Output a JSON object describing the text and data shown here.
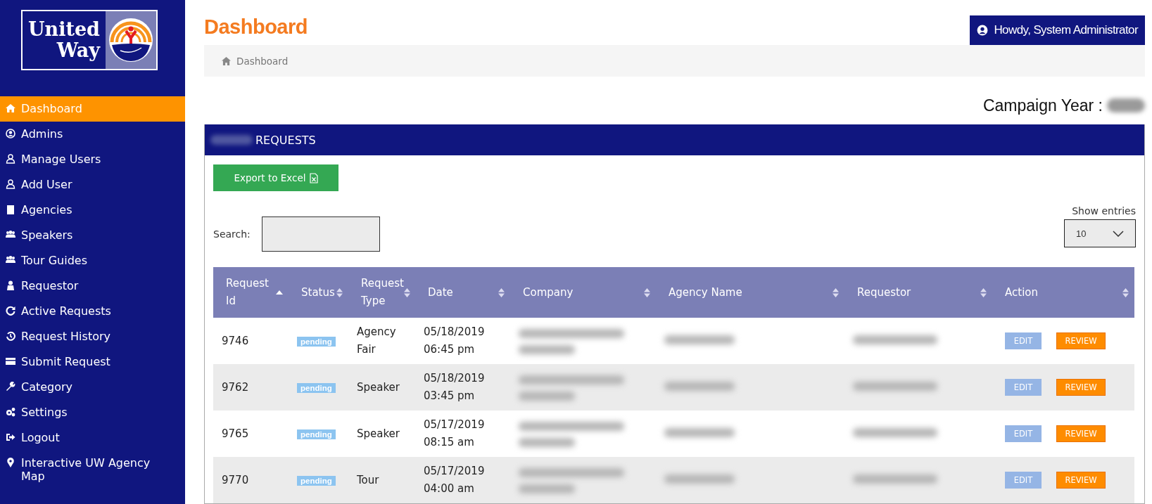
{
  "logo": {
    "line_1": "United",
    "line_2": "Way"
  },
  "sidebar": {
    "items": [
      {
        "label": "Dashboard",
        "selected": true
      },
      {
        "label": "Admins",
        "selected": false
      },
      {
        "label": "Manage Users",
        "selected": false
      },
      {
        "label": "Add User",
        "selected": false
      },
      {
        "label": "Agencies",
        "selected": false
      },
      {
        "label": "Speakers",
        "selected": false
      },
      {
        "label": "Tour Guides",
        "selected": false
      },
      {
        "label": "Requestor",
        "selected": false
      },
      {
        "label": "Active Requests",
        "selected": false
      },
      {
        "label": "Request History",
        "selected": false
      },
      {
        "label": "Submit Request",
        "selected": false
      },
      {
        "label": "Category",
        "selected": false
      },
      {
        "label": "Settings",
        "selected": false
      },
      {
        "label": "Logout",
        "selected": false
      },
      {
        "label": "Interactive UW Agency Map",
        "selected": false
      }
    ]
  },
  "page_title": "Dashboard",
  "user_button": "Howdy, System Administrator",
  "breadcrumb": "Dashboard",
  "campaign_year": {
    "label": "Campaign Year :",
    "redacted": true
  },
  "panel": {
    "title": "REQUESTS",
    "title_prefix_redacted": true,
    "export_button": "Export to Excel",
    "search_label": "Search:",
    "show_entries": {
      "label": "Show entries",
      "value": "10"
    },
    "table": {
      "columns": [
        {
          "label": "Request Id",
          "sorted": true,
          "kind": "text"
        },
        {
          "label": "Status",
          "sorted": false,
          "kind": "badge"
        },
        {
          "label": "Request Type",
          "sorted": false,
          "kind": "text"
        },
        {
          "label": "Date",
          "sorted": false,
          "kind": "text"
        },
        {
          "label": "Company",
          "sorted": false,
          "kind": "redacted"
        },
        {
          "label": "Agency Name",
          "sorted": false,
          "kind": "redacted"
        },
        {
          "label": "Requestor",
          "sorted": false,
          "kind": "redacted"
        },
        {
          "label": "Action",
          "sorted": false,
          "kind": "actions"
        }
      ],
      "rows": [
        {
          "id": "9746",
          "status": "pending",
          "type": "Agency Fair",
          "date": "05/18/2019",
          "time": "06:45 pm",
          "edit": "EDIT",
          "review": "REVIEW"
        },
        {
          "id": "9762",
          "status": "pending",
          "type": "Speaker",
          "date": "05/18/2019",
          "time": "03:45 pm",
          "edit": "EDIT",
          "review": "REVIEW"
        },
        {
          "id": "9765",
          "status": "pending",
          "type": "Speaker",
          "date": "05/17/2019",
          "time": "08:15 am",
          "edit": "EDIT",
          "review": "REVIEW"
        },
        {
          "id": "9770",
          "status": "pending",
          "type": "Tour",
          "date": "05/17/2019",
          "time": "04:00 am",
          "edit": "EDIT",
          "review": "REVIEW"
        }
      ]
    }
  }
}
